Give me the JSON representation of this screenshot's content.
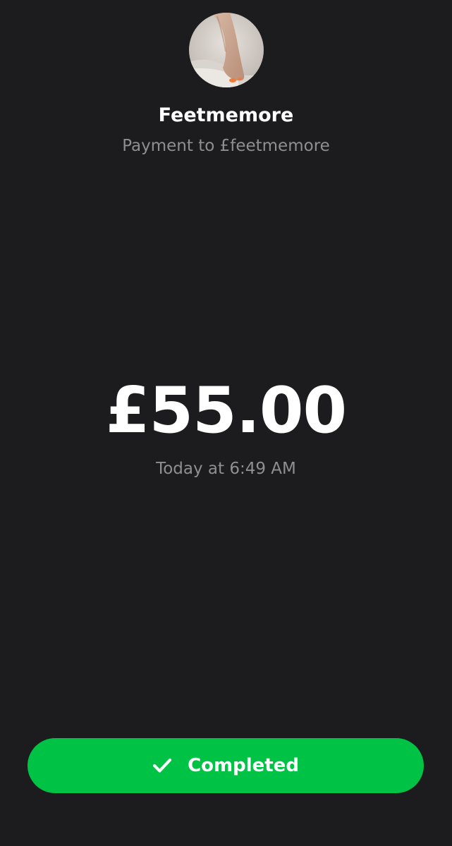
{
  "recipient": {
    "display_name": "Feetmemore",
    "subtitle": "Payment to £feetmemore",
    "avatar_icon": "profile-photo"
  },
  "payment": {
    "amount": "£55.00",
    "timestamp": "Today at 6:49 AM"
  },
  "status": {
    "label": "Completed",
    "icon": "checkmark-icon",
    "color": "#00c244"
  },
  "theme": {
    "background": "#1c1c1e",
    "secondary_text": "#8e8e93"
  }
}
